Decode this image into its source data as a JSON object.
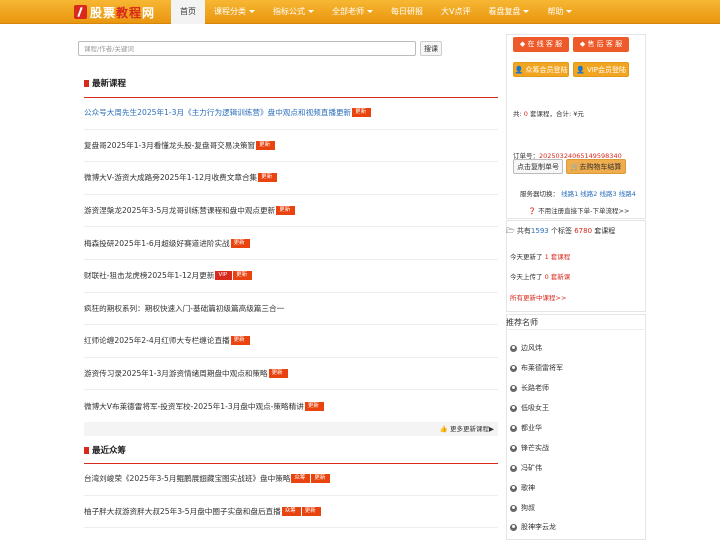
{
  "logo": {
    "w1": "股票",
    "w2": "教程",
    "w3": "网"
  },
  "nav": [
    {
      "label": "首页",
      "caret": false
    },
    {
      "label": "课程分类",
      "caret": true
    },
    {
      "label": "指标公式",
      "caret": true
    },
    {
      "label": "全部老师",
      "caret": true
    },
    {
      "label": "每日研报",
      "caret": false
    },
    {
      "label": "大V点评",
      "caret": false
    },
    {
      "label": "看盘复盘",
      "caret": true
    },
    {
      "label": "帮助",
      "caret": true
    }
  ],
  "search": {
    "placeholder": "课程/作者/关键词",
    "button": "搜课"
  },
  "latest": {
    "title": "最新课程",
    "items": [
      {
        "text": "公众号大周先生2025年1-3月《主力行为逻辑训练营》盘中观点和视频直播更新",
        "tags": [
          "更新"
        ]
      },
      {
        "text": "复盘哥2025年1-3月看懂龙头股-复盘哥交易决策窗",
        "tags": [
          "更新"
        ]
      },
      {
        "text": "微博大V-游资大成路旁2025年1-12月收费文章合集",
        "tags": [
          "更新"
        ]
      },
      {
        "text": "游资涅槃龙2025年3-5月龙哥训练营课程和盘中观点更新",
        "tags": [
          "更新"
        ]
      },
      {
        "text": "梅森投研2025年1-6月超级好赛道进阶实战",
        "tags": [
          "更新"
        ]
      },
      {
        "text": "财联社-狙击龙虎榜2025年1-12月更新",
        "tags": [
          "VIP",
          "更新"
        ]
      },
      {
        "text": "疯狂的期权系列：期权快速入门-基础篇初级篇高级篇三合一",
        "tags": []
      },
      {
        "text": "红师论缠2025年2-4月红师大专栏缠论直播",
        "tags": [
          "更新"
        ]
      },
      {
        "text": "游资传习录2025年1-3月游资情绪周期盘中观点和策略",
        "tags": [
          "更新"
        ]
      },
      {
        "text": "微博大V布莱德雷将军-投资军校-2025年1-3月盘中观点-策略精讲",
        "tags": [
          "更新"
        ]
      }
    ],
    "more": "更多更新课程▶"
  },
  "crowd": {
    "title": "最近众筹",
    "items": [
      {
        "text": "台湾刘峻荣《2025年3-5月鲲鹏展翅藏宝图实战班》盘中策略",
        "tags": [
          "众筹",
          "更新"
        ]
      },
      {
        "text": "柚子胖大叔游资胖大叔25年3-5月盘中圈子实盘和盘后直播",
        "tags": [
          "众筹",
          "更新"
        ]
      }
    ]
  },
  "sidebar": {
    "online_service": "◆ 在 线 客 服",
    "after_sales": "◆ 售 后 客 服",
    "member_login": "众筹会员登陆",
    "vip_login": "VIP会员登陆",
    "cart_prefix": "共:",
    "cart_count": "0",
    "cart_mid": "套课程，合计:",
    "cart_total": "¥元",
    "order_label": "订单号：",
    "order_no": "20250324065149598340",
    "copy_btn": "点击复制单号",
    "checkout_btn": "去购物车结算",
    "server_label": "服务器切换：",
    "servers": [
      "线路1",
      "线路2",
      "线路3",
      "线路4"
    ],
    "no_register": "❓ 不用注册直接下单-下单流程>>",
    "stats_prefix": "共有",
    "stats_courses": "1593",
    "stats_mid": "个标签",
    "stats_tags": "6780",
    "stats_suffix": "套课程",
    "today_updated_prefix": "今天更新了",
    "today_updated": "1",
    "today_updated_suffix": "套课程",
    "today_new_prefix": "今天上传了",
    "today_new": "0",
    "today_new_suffix": "套新课",
    "all_updates": "所有更新中课程>>"
  },
  "teachers": {
    "title": "推荐名师",
    "items": [
      "边风炜",
      "布莱德雷将军",
      "长路老师",
      "低吸女王",
      "都业华",
      "锋芒实战",
      "冯矿伟",
      "歌神",
      "狗叔",
      "股神李云龙"
    ]
  },
  "colors": {
    "nav_orange": "#f0a52a",
    "accent_red": "#d9281c",
    "link_blue": "#2a6ebb"
  }
}
